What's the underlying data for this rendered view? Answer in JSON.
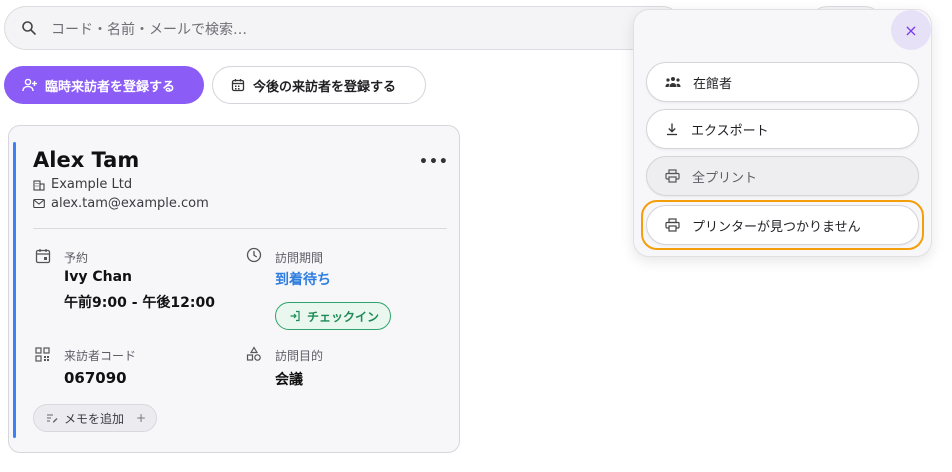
{
  "search": {
    "placeholder": "コード・名前・メールで検索…"
  },
  "actions": {
    "register_walkin": "臨時来訪者を登録する",
    "register_upcoming": "今後の来訪者を登録する"
  },
  "visitor_card": {
    "name": "Alex Tam",
    "company": "Example Ltd",
    "email": "alex.tam@example.com",
    "more": "•••",
    "booking_label": "予約",
    "host": "Ivy Chan",
    "time_range": "午前9:00 - 午後12:00",
    "visit_period_label": "訪問期間",
    "status": "到着待ち",
    "checkin_label": "チェックイン",
    "visitor_code_label": "来訪者コード",
    "visitor_code": "067090",
    "purpose_label": "訪問目的",
    "purpose": "会議",
    "add_memo": "メモを追加",
    "add_memo_plus": "+"
  },
  "menu": {
    "close": "×",
    "items": [
      {
        "label": "在館者",
        "icon": "people-icon"
      },
      {
        "label": "エクスポート",
        "icon": "download-icon"
      },
      {
        "label": "全プリント",
        "icon": "printer-icon"
      },
      {
        "label": "プリンターが見つかりません",
        "icon": "printer-icon"
      }
    ]
  },
  "colors": {
    "accent": "#8b5cf6",
    "status": "#2e7de0",
    "checkin": "#1d8a55",
    "focus": "#f59e0b",
    "card_accent": "#3b82f6"
  }
}
